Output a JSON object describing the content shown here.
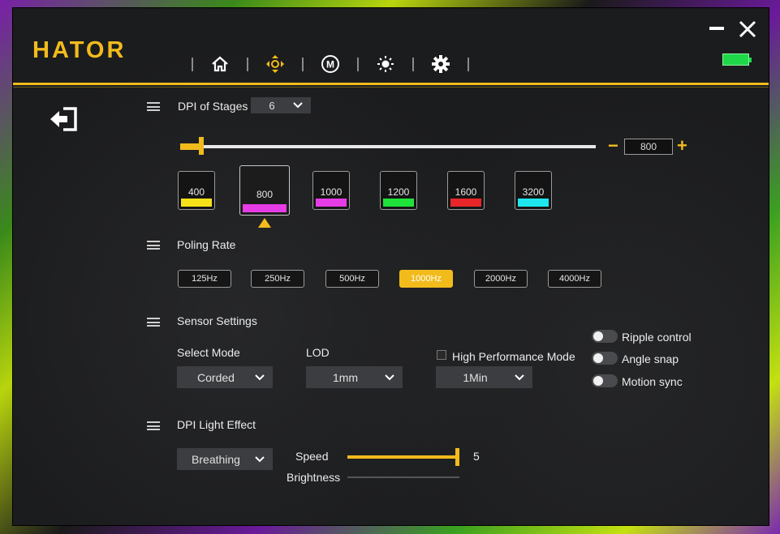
{
  "app": {
    "logo": "HATOR"
  },
  "nav": [
    {
      "icon": "home-icon"
    },
    {
      "icon": "dpi-arrows-icon",
      "active": true
    },
    {
      "icon": "macro-icon",
      "text": "M"
    },
    {
      "icon": "lighting-icon"
    },
    {
      "icon": "gear-icon"
    }
  ],
  "colors": {
    "accent": "#f2bb1c",
    "battery": "#1ed84a"
  },
  "dpi": {
    "title": "DPI of Stages",
    "stages_select": "6",
    "current_value": "800",
    "slider_fraction": 0.025,
    "stages": [
      {
        "value": "400",
        "color": "#f5e11a"
      },
      {
        "value": "800",
        "color": "#e63ce6",
        "selected": true
      },
      {
        "value": "1000",
        "color": "#e63ce6"
      },
      {
        "value": "1200",
        "color": "#1ee23a"
      },
      {
        "value": "1600",
        "color": "#e8262a"
      },
      {
        "value": "3200",
        "color": "#1ee6ee"
      }
    ],
    "minus": "−",
    "plus": "+"
  },
  "polling": {
    "title": "Poling Rate",
    "options": [
      "125Hz",
      "250Hz",
      "500Hz",
      "1000Hz",
      "2000Hz",
      "4000Hz"
    ],
    "active_index": 3
  },
  "sensor": {
    "title": "Sensor Settings",
    "select_mode_label": "Select Mode",
    "select_mode_value": "Corded",
    "lod_label": "LOD",
    "lod_value": "1mm",
    "high_perf_label": "High Performance Mode",
    "high_perf_value": "1Min",
    "toggles": [
      {
        "label": "Ripple control",
        "on": false
      },
      {
        "label": "Angle snap",
        "on": false
      },
      {
        "label": "Motion sync",
        "on": false
      }
    ]
  },
  "light": {
    "title": "DPI Light Effect",
    "effect_value": "Breathing",
    "speed_label": "Speed",
    "speed_value": "5",
    "brightness_label": "Brightness"
  }
}
